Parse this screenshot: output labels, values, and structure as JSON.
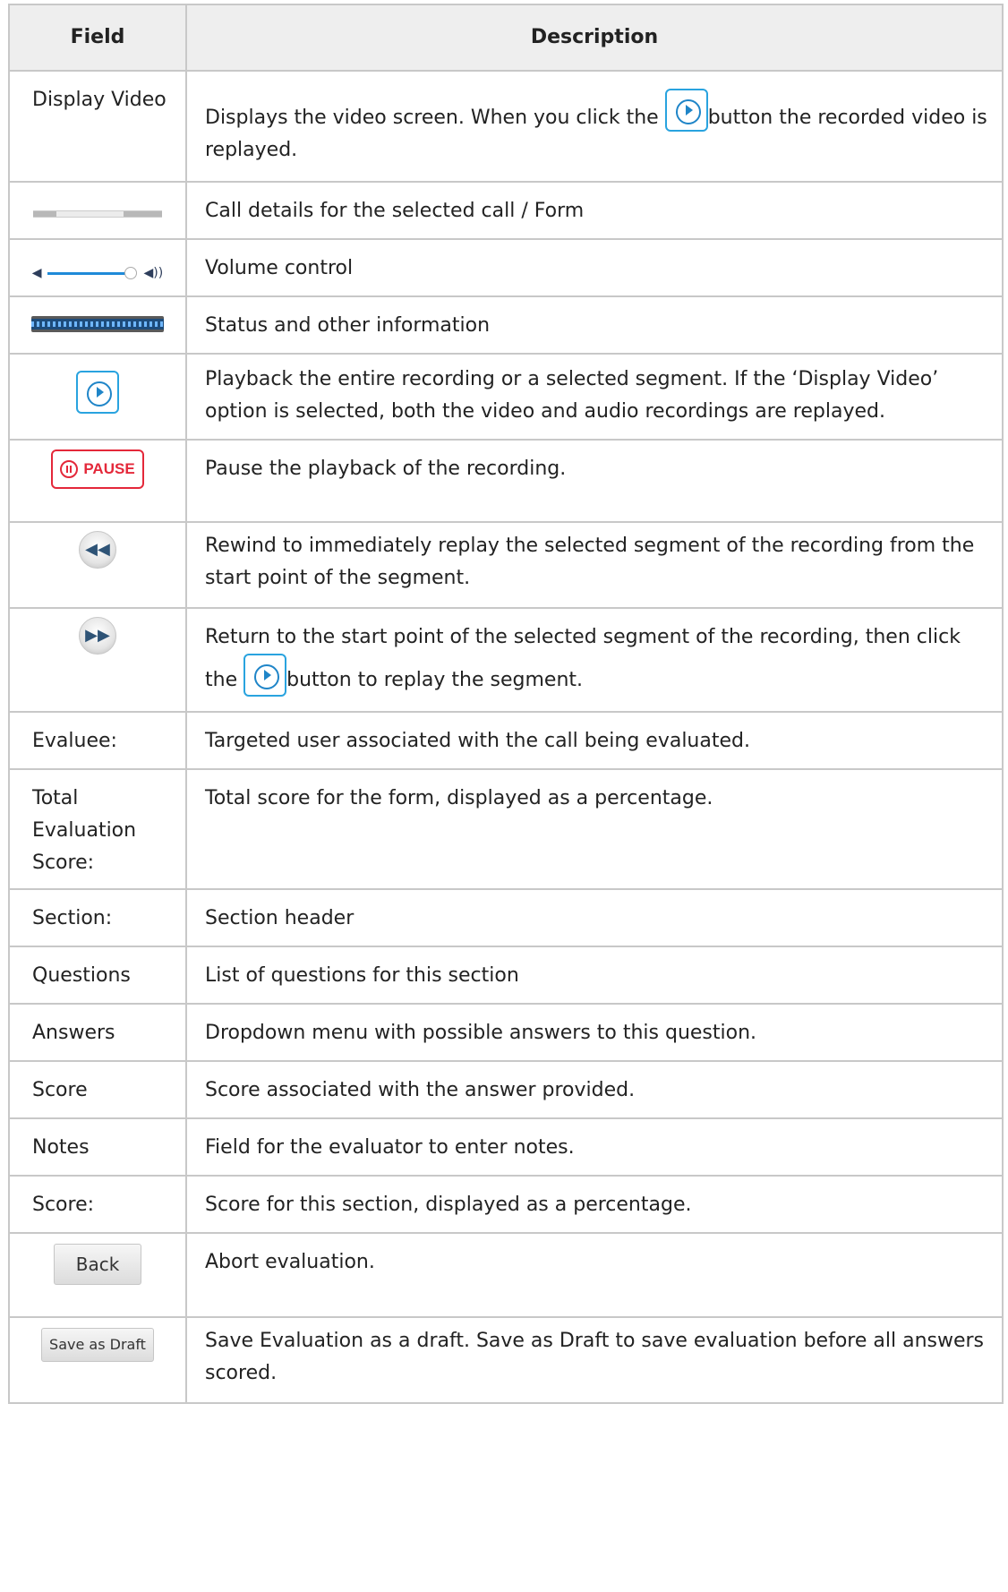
{
  "table": {
    "headers": [
      "Field",
      "Description"
    ],
    "rows": [
      {
        "field": "Display Video",
        "parts": [
          "Displays the video screen. When you click the ",
          "button the recorded video is replayed."
        ]
      },
      {
        "field": "",
        "icon": "call-details-strip",
        "description": "Call details for the selected call / Form"
      },
      {
        "field": "",
        "icon": "volume-slider",
        "description": "Volume control"
      },
      {
        "field": "",
        "icon": "waveform-status-bar",
        "description": "Status and other information"
      },
      {
        "field": "",
        "icon": "play-icon",
        "description": "Playback the entire recording or a selected segment. If the ‘Display Video’ option is selected, both the video and audio recordings are replayed."
      },
      {
        "field": "",
        "icon": "pause-button",
        "icon_label": "PAUSE",
        "description": "Pause the playback of the recording."
      },
      {
        "field": "",
        "icon": "rewind-icon",
        "description": "Rewind to immediately replay the selected segment of the recording from the start point of the segment."
      },
      {
        "field": "",
        "icon": "fast-forward-icon",
        "parts": [
          "Return to the start point of the selected segment of the recording, then click the ",
          "button to replay the segment."
        ]
      },
      {
        "field": "Evaluee:",
        "description": "Targeted user associated with the call being evaluated."
      },
      {
        "field": "Total Evaluation Score:",
        "description": "Total score for the form, displayed as a percentage."
      },
      {
        "field": "Section:",
        "description": "Section header"
      },
      {
        "field": "Questions",
        "description": "List of questions for this section"
      },
      {
        "field": "Answers",
        "description": "Dropdown menu with possible answers to this question."
      },
      {
        "field": "Score",
        "description": "Score associated with the answer provided."
      },
      {
        "field": "Notes",
        "description": "Field for the evaluator to enter notes."
      },
      {
        "field": "Score:",
        "description": "Score for this section, displayed as a percentage."
      },
      {
        "field": "",
        "icon": "back-button",
        "icon_label": "Back",
        "description": "Abort evaluation."
      },
      {
        "field": "",
        "icon": "save-as-draft-button",
        "icon_label": "Save as Draft",
        "description": "Save Evaluation as a draft. Save as Draft to save evaluation before all answers scored."
      }
    ]
  },
  "colors": {
    "border": "#c8c8c8",
    "header_bg": "#eeeeee",
    "play_blue": "#29a3df",
    "pause_red": "#e4283a"
  }
}
